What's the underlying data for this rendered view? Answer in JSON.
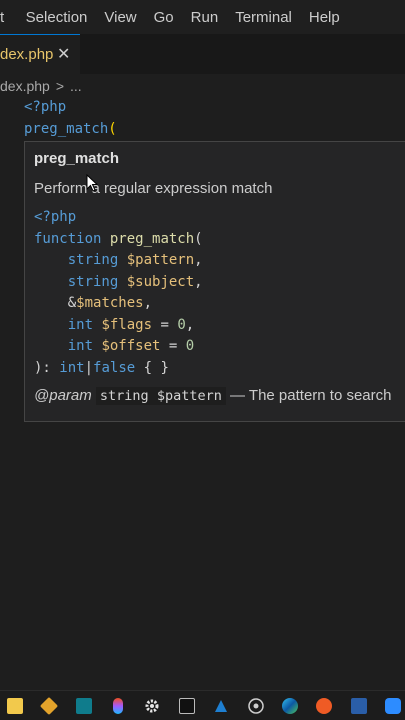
{
  "menubar": {
    "items": [
      "t",
      "Selection",
      "View",
      "Go",
      "Run",
      "Terminal",
      "Help"
    ]
  },
  "tab": {
    "label": "dex.php",
    "close": "✕"
  },
  "breadcrumb": {
    "file": "dex.php",
    "separator": ">",
    "more": "..."
  },
  "editor": {
    "line1": "<?php",
    "line2_fn": "preg_match",
    "line2_paren": "("
  },
  "hover": {
    "title": "preg_match",
    "description": "Perform a regular expression match",
    "signature": {
      "open_tag": "<?php",
      "keyword_function": "function",
      "fn_name": "preg_match",
      "open_paren": "(",
      "p1_type": "string",
      "p1_var": "$pattern",
      "p2_type": "string",
      "p2_var": "$subject",
      "p3_ref": "&",
      "p3_var": "$matches",
      "p4_type": "int",
      "p4_var": "$flags",
      "p4_default": "0",
      "p5_type": "int",
      "p5_var": "$offset",
      "p5_default": "0",
      "return_prefix": "): ",
      "return_type1": "int",
      "return_pipe": "|",
      "return_type2": "false",
      "body": " { }"
    },
    "param_doc": {
      "tag": "@param",
      "code": "string $pattern",
      "text": " — The pattern to search"
    }
  },
  "colors": {
    "accent": "#0078d4",
    "background": "#1e1e1e",
    "hover_bg": "#252526"
  },
  "taskbar": {
    "icons": [
      "file-explorer-icon",
      "git-icon",
      "terminal-app-icon",
      "figma-icon",
      "settings-icon",
      "cmd-icon",
      "edge-dev-icon",
      "chrome-icon",
      "edge-icon",
      "postman-icon",
      "powershell-icon",
      "zoom-icon"
    ]
  }
}
